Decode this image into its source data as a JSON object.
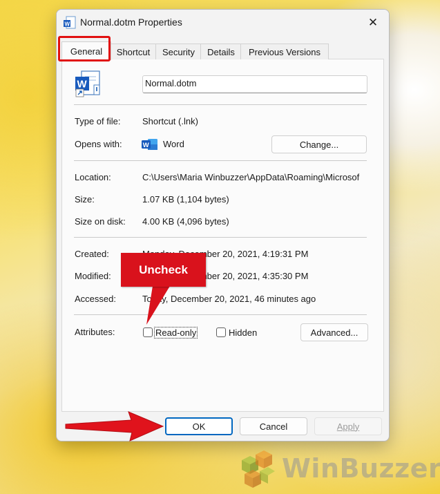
{
  "window": {
    "title": "Normal.dotm Properties"
  },
  "tabs": [
    {
      "label": "General",
      "active": true
    },
    {
      "label": "Shortcut",
      "active": false
    },
    {
      "label": "Security",
      "active": false
    },
    {
      "label": "Details",
      "active": false
    },
    {
      "label": "Previous Versions",
      "active": false
    }
  ],
  "file": {
    "name": "Normal.dotm",
    "icon": "word-template-shortcut-icon"
  },
  "info": {
    "type_label": "Type of file:",
    "type_value": "Shortcut (.lnk)",
    "opens_label": "Opens with:",
    "opens_value": "Word",
    "opens_icon": "word-icon",
    "change_button": "Change..."
  },
  "location": {
    "location_label": "Location:",
    "location_value": "C:\\Users\\Maria Winbuzzer\\AppData\\Roaming\\Microsof",
    "size_label": "Size:",
    "size_value": "1.07 KB (1,104 bytes)",
    "size_on_disk_label": "Size on disk:",
    "size_on_disk_value": "4.00 KB (4,096 bytes)"
  },
  "dates": {
    "created_label": "Created:",
    "created_value": "Monday, December 20, 2021, 4:19:31 PM",
    "modified_label": "Modified:",
    "modified_value": "Monday, December 20, 2021, 4:35:30 PM",
    "accessed_label": "Accessed:",
    "accessed_value": "Today, December 20, 2021, 46 minutes ago"
  },
  "attributes": {
    "label": "Attributes:",
    "readonly_label": "Read-only",
    "readonly_checked": false,
    "hidden_label": "Hidden",
    "hidden_checked": false,
    "advanced_button": "Advanced..."
  },
  "footer": {
    "ok": "OK",
    "cancel": "Cancel",
    "apply": "Apply"
  },
  "annotation": {
    "callout_text": "Uncheck",
    "highlight_color": "#e11010",
    "callout_color": "#d9121c"
  },
  "watermark": {
    "text": "WinBuzzer"
  },
  "colors": {
    "primary_border": "#0067c0"
  }
}
